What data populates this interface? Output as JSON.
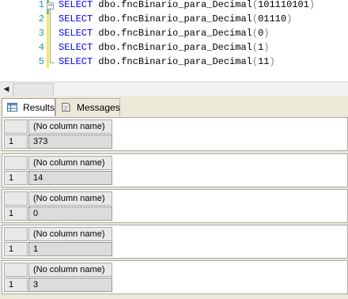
{
  "editor": {
    "lines": [
      {
        "num": "1",
        "keyword": "SELECT",
        "func": "dbo.fncBinario_para_Decimal",
        "arg": "101110101"
      },
      {
        "num": "2",
        "keyword": "SELECT",
        "func": "dbo.fncBinario_para_Decimal",
        "arg": "01110"
      },
      {
        "num": "3",
        "keyword": "SELECT",
        "func": "dbo.fncBinario_para_Decimal",
        "arg": "0"
      },
      {
        "num": "4",
        "keyword": "SELECT",
        "func": "dbo.fncBinario_para_Decimal",
        "arg": "1"
      },
      {
        "num": "5",
        "keyword": "SELECT",
        "func": "dbo.fncBinario_para_Decimal",
        "arg": "11"
      }
    ],
    "fold_glyph": "−"
  },
  "scrollbar": {
    "left_arrow": "◀"
  },
  "tabs": [
    {
      "label": "Results",
      "icon": "grid-icon",
      "active": true
    },
    {
      "label": "Messages",
      "icon": "messages-icon",
      "active": false
    }
  ],
  "results": [
    {
      "column_header": "(No column name)",
      "row_number": "1",
      "value": "373"
    },
    {
      "column_header": "(No column name)",
      "row_number": "1",
      "value": "14"
    },
    {
      "column_header": "(No column name)",
      "row_number": "1",
      "value": "0"
    },
    {
      "column_header": "(No column name)",
      "row_number": "1",
      "value": "1"
    },
    {
      "column_header": "(No column name)",
      "row_number": "1",
      "value": "3"
    }
  ],
  "colors": {
    "keyword": "#0000ff",
    "line_number": "#2b91af",
    "punctuation": "#808080",
    "panel_background": "#ece9d8"
  }
}
